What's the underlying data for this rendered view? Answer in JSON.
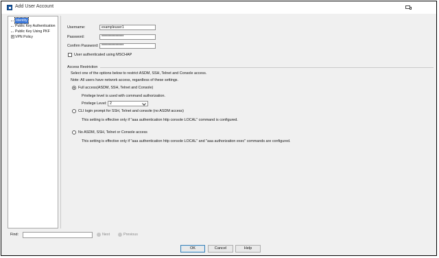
{
  "window": {
    "title": "Add User Account"
  },
  "tree": {
    "items": [
      {
        "label": "Identity",
        "selected": true
      },
      {
        "label": "Public Key Authentication"
      },
      {
        "label": "Public Key Using PKF"
      },
      {
        "label": "VPN Policy",
        "expandable": true,
        "expander": "+"
      }
    ]
  },
  "identity": {
    "username_label": "Username:",
    "username_value": "exampleuser1",
    "password_label": "Password:",
    "password_value": "****************",
    "confirm_label": "Confirm Password:",
    "confirm_value": "****************",
    "mschap_label": "User authenticated using MSCHAP",
    "mschap_checked": false
  },
  "access": {
    "section_title": "Access Restriction",
    "instruction": "Select one of the options below to restrict ASDM, SSH, Telnet and Console access.",
    "note": "Note: All users have network access, regardless of these settings.",
    "full_label": "Full access(ASDM, SSH, Telnet and Console)",
    "full_desc": "Privilege level is used with command authorization.",
    "privilege_label": "Privilege Level:",
    "privilege_value": "2",
    "cli_label": "CLI login prompt for SSH, Telnet and console (no ASDM access)",
    "cli_desc": "This setting is effective only if \"aaa authentication http console LOCAL\" command is configured.",
    "none_label": "No ASDM, SSH, Telnet or Console access",
    "none_desc": "This setting is effective only if \"aaa authentication http console LOCAL\" and \"aaa authorization exec\" commands are configured.",
    "selected": "full"
  },
  "find": {
    "label": "Find:",
    "value": "",
    "next": "Next",
    "previous": "Previous"
  },
  "buttons": {
    "ok": "OK",
    "cancel": "Cancel",
    "help": "Help"
  },
  "icons": {
    "app": "app-icon",
    "restore": "restore-icon",
    "next": "next-icon",
    "previous": "previous-icon"
  }
}
